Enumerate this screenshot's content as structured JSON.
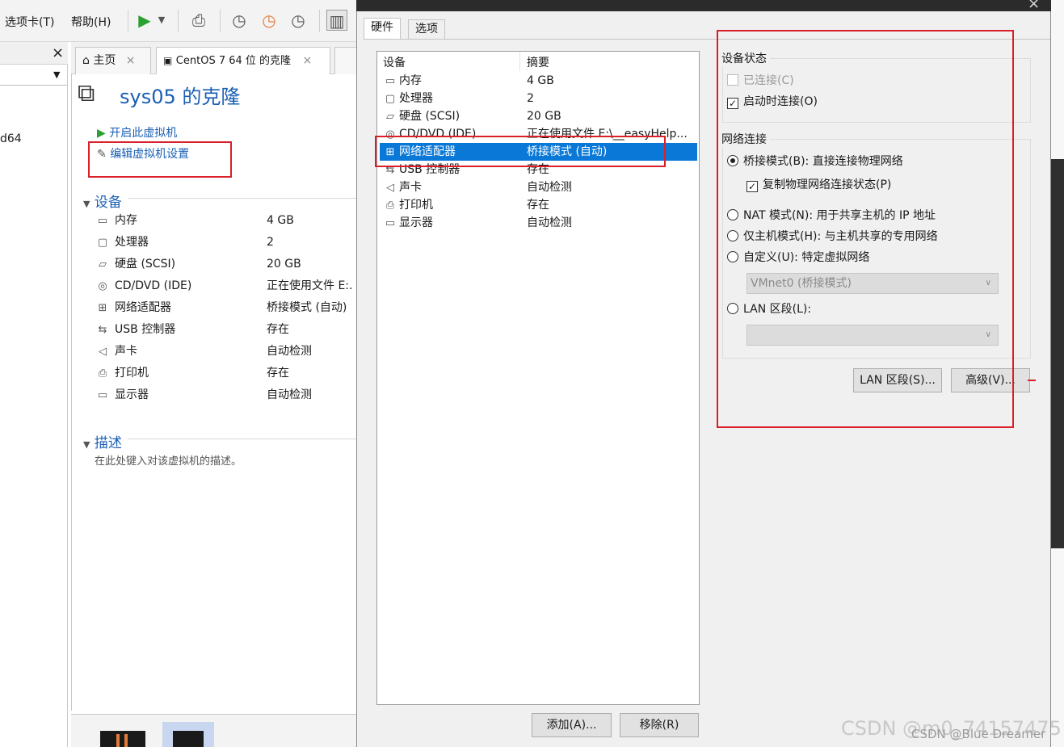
{
  "menu": {
    "tabs_label": "选项卡(T)",
    "help_label": "帮助(H)"
  },
  "left_panel": {
    "close_glyph": "×",
    "partial_text": "d64"
  },
  "vm_tabs": [
    {
      "label": "主页",
      "close": "×"
    },
    {
      "label": "CentOS 7 64 位 的克隆",
      "close": "×"
    }
  ],
  "vm": {
    "title": "sys05 的克隆",
    "power_on": "开启此虚拟机",
    "edit_settings": "编辑虚拟机设置",
    "devices_header": "设备",
    "devices": [
      {
        "name": "内存",
        "value": "4 GB",
        "icon": "memory-icon"
      },
      {
        "name": "处理器",
        "value": "2",
        "icon": "cpu-icon"
      },
      {
        "name": "硬盘 (SCSI)",
        "value": "20 GB",
        "icon": "harddisk-icon"
      },
      {
        "name": "CD/DVD (IDE)",
        "value": "正在使用文件 E:.",
        "icon": "cdrom-icon"
      },
      {
        "name": "网络适配器",
        "value": "桥接模式 (自动)",
        "icon": "network-icon"
      },
      {
        "name": "USB 控制器",
        "value": "存在",
        "icon": "usb-icon"
      },
      {
        "name": "声卡",
        "value": "自动检测",
        "icon": "sound-icon"
      },
      {
        "name": "打印机",
        "value": "存在",
        "icon": "printer-icon"
      },
      {
        "name": "显示器",
        "value": "自动检测",
        "icon": "display-icon"
      }
    ],
    "description_header": "描述",
    "description_placeholder": "在此处键入对该虚拟机的描述。"
  },
  "dialog": {
    "tabs": [
      "硬件",
      "选项"
    ],
    "list_headers": {
      "device": "设备",
      "summary": "摘要"
    },
    "hardware": [
      {
        "name": "内存",
        "summary": "4 GB"
      },
      {
        "name": "处理器",
        "summary": "2"
      },
      {
        "name": "硬盘 (SCSI)",
        "summary": "20 GB"
      },
      {
        "name": "CD/DVD (IDE)",
        "summary": "正在使用文件 E:\\__easyHelp..."
      },
      {
        "name": "网络适配器",
        "summary": "桥接模式 (自动)"
      },
      {
        "name": "USB 控制器",
        "summary": "存在"
      },
      {
        "name": "声卡",
        "summary": "自动检测"
      },
      {
        "name": "打印机",
        "summary": "存在"
      },
      {
        "name": "显示器",
        "summary": "自动检测"
      }
    ],
    "selected_index": 4,
    "add_button": "添加(A)...",
    "remove_button": "移除(R)",
    "device_status": {
      "label": "设备状态",
      "connected": "已连接(C)",
      "connect_at_power_on": "启动时连接(O)"
    },
    "network": {
      "label": "网络连接",
      "bridged": "桥接模式(B): 直接连接物理网络",
      "replicate": "复制物理网络连接状态(P)",
      "nat": "NAT 模式(N): 用于共享主机的 IP 地址",
      "host_only": "仅主机模式(H): 与主机共享的专用网络",
      "custom": "自定义(U): 特定虚拟网络",
      "custom_value": "VMnet0 (桥接模式)",
      "lan_segment": "LAN 区段(L):",
      "lan_segments_button": "LAN 区段(S)...",
      "advanced_button": "高级(V)..."
    }
  },
  "watermark": "CSDN @m0_74157475",
  "watermark2": "CSDN @Blue Dreamer",
  "colors": {
    "selection": "#0a78d7",
    "highlight_box": "#d9202a",
    "link": "#1a5fb4"
  }
}
